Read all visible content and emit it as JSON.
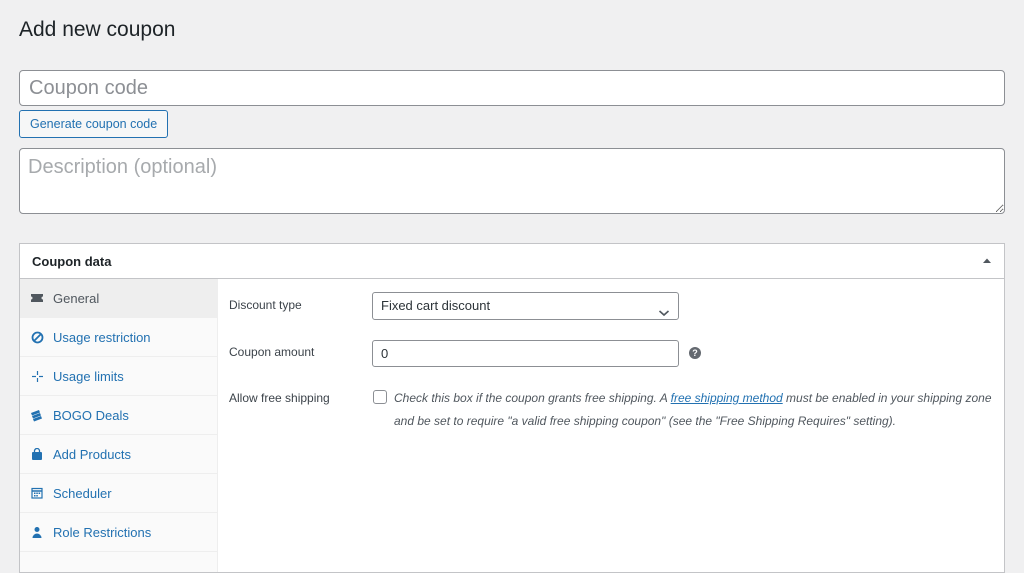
{
  "page": {
    "title": "Add new coupon"
  },
  "coupon_code": {
    "placeholder": "Coupon code",
    "value": ""
  },
  "generate_button": {
    "label": "Generate coupon code"
  },
  "description": {
    "placeholder": "Description (optional)",
    "value": ""
  },
  "coupon_data": {
    "title": "Coupon data",
    "tabs": [
      {
        "label": "General",
        "icon": "ticket-icon",
        "active": true
      },
      {
        "label": "Usage restriction",
        "icon": "block-icon"
      },
      {
        "label": "Usage limits",
        "icon": "crosshair-icon"
      },
      {
        "label": "BOGO Deals",
        "icon": "tickets-stack-icon"
      },
      {
        "label": "Add Products",
        "icon": "bag-icon"
      },
      {
        "label": "Scheduler",
        "icon": "calendar-icon"
      },
      {
        "label": "Role Restrictions",
        "icon": "user-icon"
      }
    ],
    "general": {
      "discount_type": {
        "label": "Discount type",
        "value": "Fixed cart discount"
      },
      "coupon_amount": {
        "label": "Coupon amount",
        "value": "0"
      },
      "free_shipping": {
        "label": "Allow free shipping",
        "checked": false,
        "text_before": "Check this box if the coupon grants free shipping. A ",
        "link_text": "free shipping method",
        "text_after": " must be enabled in your shipping zone and be set to require \"a valid free shipping coupon\" (see the \"Free Shipping Requires\" setting)."
      }
    }
  },
  "colors": {
    "accent": "#2271b1",
    "background": "#f0f0f1"
  }
}
